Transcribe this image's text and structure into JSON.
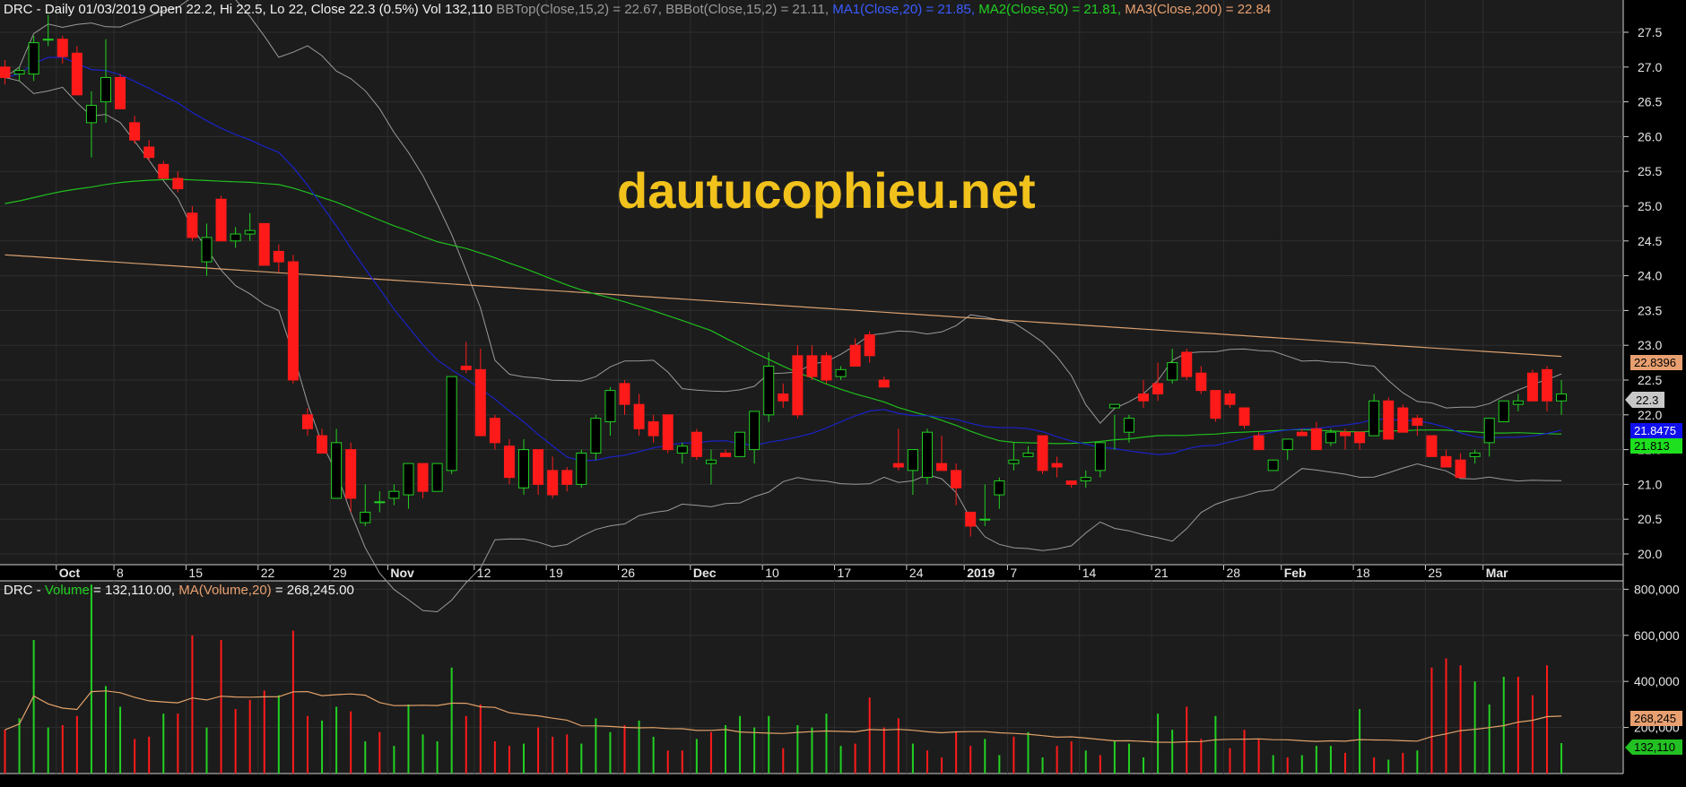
{
  "header": {
    "symbol": "DRC",
    "info": " - Daily 01/03/2019 Open 22.2, Hi 22.5, Lo 22, Close 22.3 (0.5%) Vol 132,110 ",
    "bbtop": "BBTop(Close,15,2) = 22.67, ",
    "bbbot": "BBBot(Close,15,2) = 21.11, ",
    "ma1": "MA1(Close,20) = 21.85, ",
    "ma2": "MA2(Close,50) = 21.81, ",
    "ma3": "MA3(Close,200) = 22.84"
  },
  "volume_header": {
    "prefix": "DRC - ",
    "volume": "Volume",
    "volume_value": " = 132,110.00, ",
    "ma": "MA(Volume,20)",
    "ma_value": " = 268,245.00"
  },
  "watermark": "dautucophieu.net",
  "colors": {
    "up": "#22d022",
    "down": "#ff1a1a",
    "ma1": "#1a22c8",
    "ma2": "#1fbf1f",
    "ma3": "#d9a070",
    "bband": "#9a9a9a",
    "volma": "#e2a26a"
  },
  "tags": {
    "ma3": "22.8396",
    "close": "22.3",
    "ma1": "21.8475",
    "ma2": "21.813",
    "vol_ma": "268,245",
    "vol": "132,110"
  },
  "chart_data": {
    "type": "candlestick",
    "price_ticks": [
      "27.5",
      "27.0",
      "26.5",
      "26.0",
      "25.5",
      "25.0",
      "24.5",
      "24.0",
      "23.5",
      "23.0",
      "22.5",
      "22.0",
      "21.5",
      "21.0",
      "20.5",
      "20.0"
    ],
    "volume_ticks": [
      "800,000",
      "600,000",
      "400,000",
      "200,000"
    ],
    "date_labels": [
      {
        "t": "Oct",
        "i": 4,
        "bold": true
      },
      {
        "t": "8",
        "i": 8
      },
      {
        "t": "15",
        "i": 13
      },
      {
        "t": "22",
        "i": 18
      },
      {
        "t": "29",
        "i": 23
      },
      {
        "t": "Nov",
        "i": 27,
        "bold": true
      },
      {
        "t": "12",
        "i": 33
      },
      {
        "t": "19",
        "i": 38
      },
      {
        "t": "26",
        "i": 43
      },
      {
        "t": "Dec",
        "i": 48,
        "bold": true
      },
      {
        "t": "10",
        "i": 53
      },
      {
        "t": "17",
        "i": 58
      },
      {
        "t": "24",
        "i": 63
      },
      {
        "t": "2019",
        "i": 67,
        "bold": true
      },
      {
        "t": "7",
        "i": 70
      },
      {
        "t": "14",
        "i": 75
      },
      {
        "t": "21",
        "i": 80
      },
      {
        "t": "28",
        "i": 85
      },
      {
        "t": "Feb",
        "i": 89,
        "bold": true
      },
      {
        "t": "18",
        "i": 94
      },
      {
        "t": "25",
        "i": 99
      },
      {
        "t": "Mar",
        "i": 103,
        "bold": true
      }
    ],
    "ohlc": [
      [
        27.0,
        27.1,
        26.75,
        26.85
      ],
      [
        26.9,
        27.0,
        26.8,
        26.95
      ],
      [
        26.9,
        27.45,
        26.8,
        27.35
      ],
      [
        27.4,
        27.75,
        27.3,
        27.4
      ],
      [
        27.4,
        27.45,
        27.05,
        27.15
      ],
      [
        27.2,
        27.3,
        26.6,
        26.6
      ],
      [
        26.2,
        26.65,
        25.7,
        26.45
      ],
      [
        26.5,
        27.4,
        26.2,
        26.85
      ],
      [
        26.85,
        26.9,
        26.4,
        26.4
      ],
      [
        26.2,
        26.3,
        25.9,
        25.95
      ],
      [
        25.85,
        25.95,
        25.65,
        25.7
      ],
      [
        25.6,
        25.65,
        25.4,
        25.4
      ],
      [
        25.4,
        25.5,
        25.2,
        25.25
      ],
      [
        24.9,
        25.0,
        24.5,
        24.55
      ],
      [
        24.2,
        24.75,
        24.0,
        24.55
      ],
      [
        25.1,
        25.15,
        24.5,
        24.5
      ],
      [
        24.5,
        24.7,
        24.4,
        24.6
      ],
      [
        24.6,
        24.9,
        24.5,
        24.65
      ],
      [
        24.75,
        24.75,
        24.2,
        24.15
      ],
      [
        24.35,
        24.45,
        24.05,
        24.2
      ],
      [
        24.2,
        24.3,
        22.45,
        22.5
      ],
      [
        22.0,
        22.1,
        21.7,
        21.8
      ],
      [
        21.7,
        21.8,
        21.45,
        21.45
      ],
      [
        20.8,
        21.8,
        20.8,
        21.6
      ],
      [
        21.5,
        21.6,
        20.6,
        20.8
      ],
      [
        20.45,
        21.0,
        20.4,
        20.6
      ],
      [
        20.75,
        20.9,
        20.6,
        20.75
      ],
      [
        20.8,
        21.0,
        20.7,
        20.9
      ],
      [
        20.85,
        21.3,
        20.65,
        21.3
      ],
      [
        21.3,
        21.3,
        20.8,
        20.9
      ],
      [
        20.9,
        21.3,
        20.9,
        21.3
      ],
      [
        21.2,
        22.55,
        21.15,
        22.55
      ],
      [
        22.7,
        23.05,
        22.6,
        22.65
      ],
      [
        22.65,
        22.95,
        21.8,
        21.7
      ],
      [
        21.95,
        22.0,
        21.5,
        21.6
      ],
      [
        21.55,
        21.65,
        21.0,
        21.1
      ],
      [
        20.95,
        21.65,
        20.85,
        21.5
      ],
      [
        21.5,
        21.5,
        20.85,
        21.0
      ],
      [
        21.2,
        21.4,
        20.8,
        20.85
      ],
      [
        21.2,
        21.25,
        20.9,
        21.0
      ],
      [
        21.0,
        21.5,
        20.95,
        21.45
      ],
      [
        21.45,
        22.0,
        21.35,
        21.95
      ],
      [
        21.9,
        22.4,
        21.7,
        22.35
      ],
      [
        22.45,
        22.5,
        22.0,
        22.15
      ],
      [
        22.15,
        22.3,
        21.7,
        21.8
      ],
      [
        21.9,
        22.0,
        21.6,
        21.7
      ],
      [
        22.0,
        22.0,
        21.45,
        21.5
      ],
      [
        21.45,
        21.6,
        21.3,
        21.55
      ],
      [
        21.75,
        21.8,
        21.35,
        21.4
      ],
      [
        21.3,
        21.5,
        21.0,
        21.35
      ],
      [
        21.45,
        21.5,
        21.4,
        21.4
      ],
      [
        21.4,
        21.6,
        21.4,
        21.75
      ],
      [
        21.5,
        22.0,
        21.3,
        22.05
      ],
      [
        22.0,
        22.9,
        21.9,
        22.7
      ],
      [
        22.3,
        22.45,
        22.1,
        22.2
      ],
      [
        22.85,
        23.0,
        21.95,
        22.0
      ],
      [
        22.85,
        23.0,
        22.5,
        22.55
      ],
      [
        22.85,
        22.9,
        22.45,
        22.5
      ],
      [
        22.55,
        22.7,
        22.5,
        22.65
      ],
      [
        23.0,
        23.1,
        22.7,
        22.7
      ],
      [
        23.15,
        23.2,
        22.75,
        22.85
      ],
      [
        22.5,
        22.55,
        22.4,
        22.4
      ],
      [
        21.3,
        21.8,
        21.2,
        21.25
      ],
      [
        21.2,
        21.3,
        20.85,
        21.5
      ],
      [
        21.1,
        21.8,
        21.0,
        21.75
      ],
      [
        21.3,
        21.7,
        21.2,
        21.2
      ],
      [
        21.2,
        21.3,
        20.7,
        20.95
      ],
      [
        20.6,
        20.6,
        20.25,
        20.4
      ],
      [
        20.5,
        21.0,
        20.4,
        20.5
      ],
      [
        20.85,
        21.1,
        20.65,
        21.05
      ],
      [
        21.3,
        21.6,
        21.2,
        21.35
      ],
      [
        21.4,
        21.55,
        21.4,
        21.45
      ],
      [
        21.7,
        21.7,
        21.15,
        21.2
      ],
      [
        21.3,
        21.4,
        21.1,
        21.25
      ],
      [
        21.05,
        21.05,
        20.95,
        21.0
      ],
      [
        21.05,
        21.2,
        20.95,
        21.1
      ],
      [
        21.2,
        21.6,
        21.1,
        21.6
      ],
      [
        22.1,
        22.0,
        21.5,
        22.15
      ],
      [
        21.75,
        22.0,
        21.6,
        21.95
      ],
      [
        22.3,
        22.5,
        22.1,
        22.2
      ],
      [
        22.45,
        22.75,
        22.2,
        22.3
      ],
      [
        22.5,
        22.95,
        22.45,
        22.75
      ],
      [
        22.9,
        22.95,
        22.5,
        22.55
      ],
      [
        22.6,
        22.7,
        22.3,
        22.35
      ],
      [
        22.35,
        22.35,
        21.9,
        21.95
      ],
      [
        22.3,
        22.35,
        22.1,
        22.15
      ],
      [
        22.1,
        22.1,
        21.8,
        21.85
      ],
      [
        21.7,
        21.75,
        21.5,
        21.5
      ],
      [
        21.2,
        21.2,
        21.3,
        21.35
      ],
      [
        21.5,
        21.65,
        21.35,
        21.65
      ],
      [
        21.75,
        21.8,
        21.7,
        21.7
      ],
      [
        21.8,
        21.9,
        21.5,
        21.5
      ],
      [
        21.6,
        21.8,
        21.55,
        21.75
      ],
      [
        21.75,
        21.8,
        21.5,
        21.7
      ],
      [
        21.75,
        21.75,
        21.5,
        21.6
      ],
      [
        21.7,
        22.3,
        21.7,
        22.2
      ],
      [
        22.2,
        22.25,
        21.65,
        21.65
      ],
      [
        22.1,
        22.15,
        21.75,
        21.75
      ],
      [
        21.95,
        22.0,
        21.7,
        21.85
      ],
      [
        21.7,
        21.7,
        21.45,
        21.4
      ],
      [
        21.4,
        21.5,
        21.25,
        21.25
      ],
      [
        21.35,
        21.45,
        21.1,
        21.1
      ],
      [
        21.4,
        21.5,
        21.3,
        21.45
      ],
      [
        21.6,
        21.7,
        21.4,
        21.95
      ],
      [
        21.9,
        22.2,
        21.95,
        22.2
      ],
      [
        22.15,
        22.3,
        22.05,
        22.2
      ],
      [
        22.6,
        22.65,
        22.2,
        22.2
      ],
      [
        22.65,
        22.7,
        22.05,
        22.2
      ],
      [
        22.2,
        22.5,
        22.0,
        22.3
      ]
    ],
    "volume": [
      [
        190000,
        0
      ],
      [
        240000,
        1
      ],
      [
        580000,
        1
      ],
      [
        200000,
        1
      ],
      [
        210000,
        0
      ],
      [
        250000,
        0
      ],
      [
        820000,
        1
      ],
      [
        380000,
        1
      ],
      [
        290000,
        1
      ],
      [
        150000,
        0
      ],
      [
        160000,
        0
      ],
      [
        260000,
        1
      ],
      [
        260000,
        0
      ],
      [
        600000,
        0
      ],
      [
        200000,
        1
      ],
      [
        580000,
        0
      ],
      [
        280000,
        0
      ],
      [
        320000,
        0
      ],
      [
        360000,
        0
      ],
      [
        340000,
        1
      ],
      [
        620000,
        0
      ],
      [
        250000,
        0
      ],
      [
        230000,
        1
      ],
      [
        290000,
        1
      ],
      [
        270000,
        0
      ],
      [
        140000,
        1
      ],
      [
        180000,
        0
      ],
      [
        120000,
        1
      ],
      [
        300000,
        1
      ],
      [
        170000,
        1
      ],
      [
        140000,
        1
      ],
      [
        460000,
        1
      ],
      [
        250000,
        0
      ],
      [
        300000,
        0
      ],
      [
        140000,
        0
      ],
      [
        120000,
        0
      ],
      [
        130000,
        1
      ],
      [
        200000,
        0
      ],
      [
        160000,
        0
      ],
      [
        170000,
        0
      ],
      [
        130000,
        1
      ],
      [
        240000,
        1
      ],
      [
        180000,
        1
      ],
      [
        210000,
        0
      ],
      [
        230000,
        1
      ],
      [
        160000,
        1
      ],
      [
        100000,
        0
      ],
      [
        100000,
        0
      ],
      [
        150000,
        1
      ],
      [
        180000,
        0
      ],
      [
        210000,
        1
      ],
      [
        250000,
        1
      ],
      [
        200000,
        1
      ],
      [
        250000,
        1
      ],
      [
        110000,
        0
      ],
      [
        210000,
        1
      ],
      [
        200000,
        1
      ],
      [
        260000,
        1
      ],
      [
        120000,
        1
      ],
      [
        130000,
        0
      ],
      [
        330000,
        0
      ],
      [
        200000,
        0
      ],
      [
        240000,
        0
      ],
      [
        130000,
        1
      ],
      [
        100000,
        0
      ],
      [
        70000,
        0
      ],
      [
        180000,
        0
      ],
      [
        120000,
        0
      ],
      [
        150000,
        1
      ],
      [
        80000,
        1
      ],
      [
        160000,
        0
      ],
      [
        180000,
        1
      ],
      [
        70000,
        1
      ],
      [
        120000,
        0
      ],
      [
        140000,
        0
      ],
      [
        100000,
        1
      ],
      [
        80000,
        0
      ],
      [
        140000,
        1
      ],
      [
        130000,
        1
      ],
      [
        70000,
        1
      ],
      [
        260000,
        1
      ],
      [
        190000,
        1
      ],
      [
        290000,
        0
      ],
      [
        150000,
        0
      ],
      [
        250000,
        1
      ],
      [
        110000,
        0
      ],
      [
        190000,
        0
      ],
      [
        150000,
        0
      ],
      [
        80000,
        1
      ],
      [
        70000,
        0
      ],
      [
        80000,
        1
      ],
      [
        120000,
        1
      ],
      [
        120000,
        1
      ],
      [
        90000,
        0
      ],
      [
        280000,
        1
      ],
      [
        70000,
        0
      ],
      [
        60000,
        1
      ],
      [
        90000,
        0
      ],
      [
        100000,
        1
      ],
      [
        460000,
        0
      ],
      [
        500000,
        0
      ],
      [
        470000,
        0
      ],
      [
        400000,
        1
      ],
      [
        300000,
        1
      ],
      [
        420000,
        1
      ],
      [
        420000,
        0
      ],
      [
        340000,
        0
      ],
      [
        470000,
        0
      ],
      [
        132110,
        1
      ]
    ]
  }
}
